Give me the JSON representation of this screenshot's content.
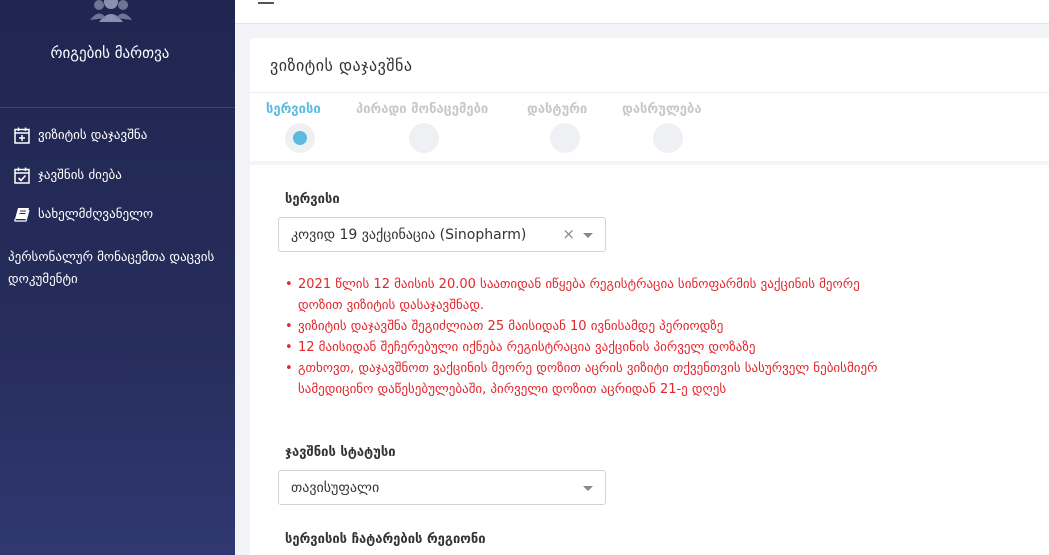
{
  "sidebar": {
    "app_title": "რიგების მართვა",
    "items": [
      {
        "label": "ვიზიტის დაჯავშნა",
        "icon": "calendar-plus-icon"
      },
      {
        "label": "ჯავშნის ძიება",
        "icon": "calendar-check-icon"
      },
      {
        "label": "სახელმძღვანელო",
        "icon": "book-icon"
      },
      {
        "label": "პერსონალურ მონაცემთა დაცვის დოკუმენტი",
        "icon": ""
      }
    ]
  },
  "card": {
    "title": "ვიზიტის დაჯავშნა"
  },
  "steps": [
    {
      "label": "სერვისი",
      "active": true
    },
    {
      "label": "პირადი მონაცემები",
      "active": false
    },
    {
      "label": "დასტური",
      "active": false
    },
    {
      "label": "დასრულება",
      "active": false
    }
  ],
  "service": {
    "label": "სერვისი",
    "value": "კოვიდ 19 ვაქცინაცია (Sinopharm)",
    "clear": "×"
  },
  "notes": [
    "2021 წლის 12 მაისის 20.00 საათიდან იწყება რეგისტრაცია სინოფარმის ვაქცინის მეორე დოზით ვიზიტის დასაჯავშნად.",
    "ვიზიტის დაჯავშნა შეგიძლიათ 25 მაისიდან 10 ივნისამდე პერიოდზე",
    "12 მაისიდან შეჩერებული იქნება რეგისტრაცია ვაქცინის პირველ დოზაზე",
    "გთხოვთ, დაჯავშნოთ ვაქცინის მეორე დოზით აცრის ვიზიტი თქვენთვის სასურველ ნებისმიერ სამედიცინო დაწესებულებაში, პირველი დოზით აცრიდან 21-ე დღეს"
  ],
  "status": {
    "label": "ჯავშნის სტატუსი",
    "value": "თავისუფალი"
  },
  "region": {
    "label": "სერვისის ჩატარების რეგიონი"
  },
  "colors": {
    "sidebar_bg": "#262d5c",
    "accent": "#5bbbe0",
    "warning": "#e3262c"
  }
}
